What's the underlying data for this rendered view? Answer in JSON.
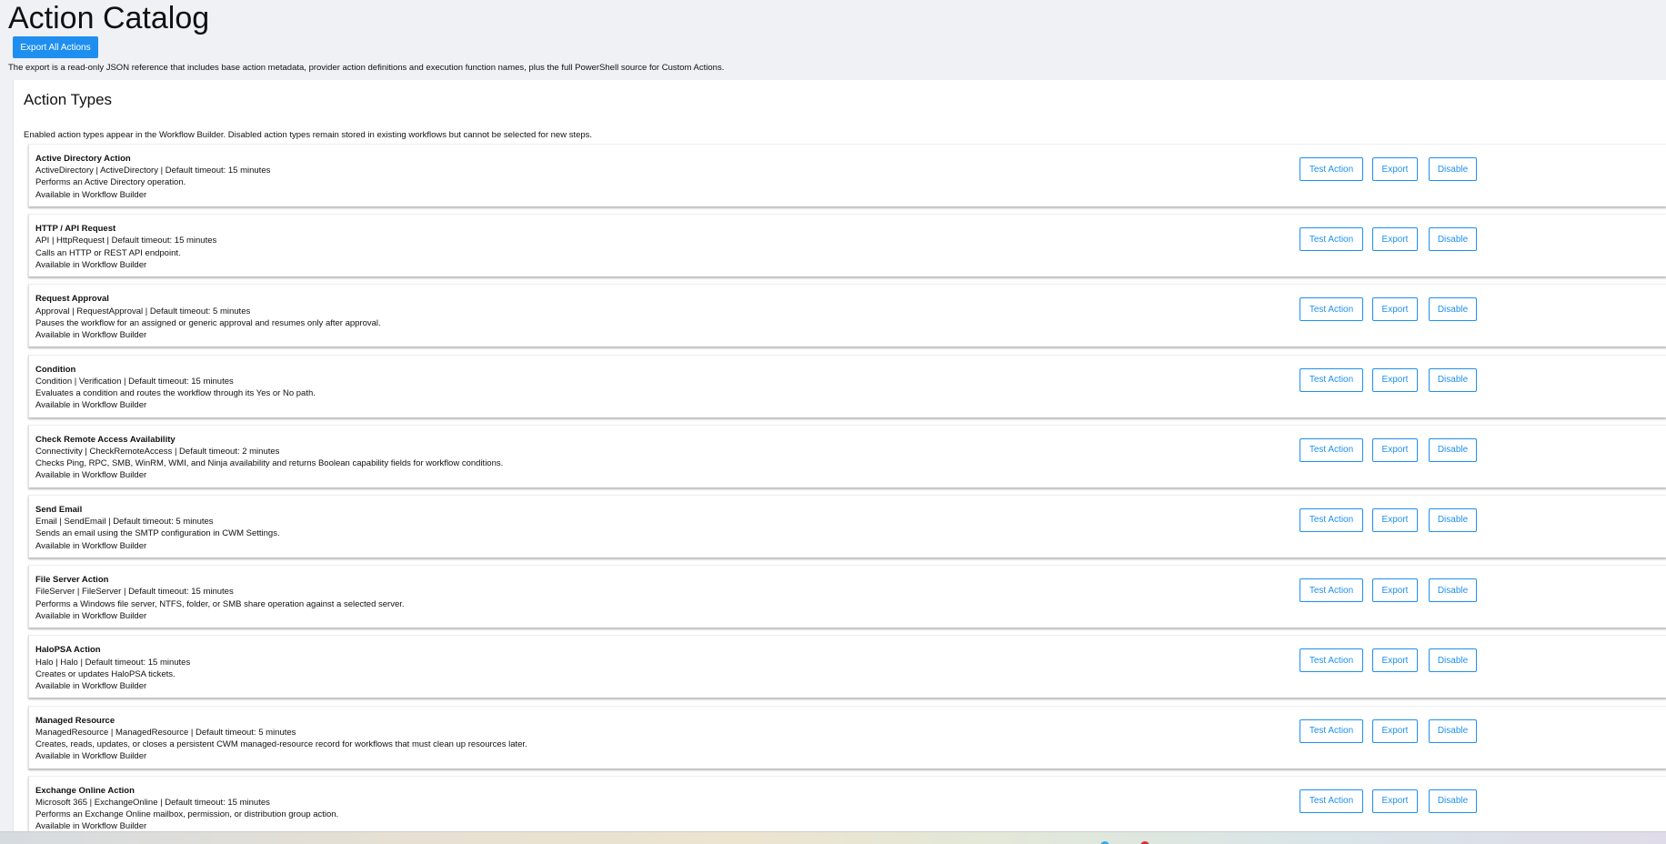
{
  "page": {
    "title": "Action Catalog",
    "export_all_label": "Export All Actions",
    "export_note": "The export is a read-only JSON reference that includes base action metadata, provider action definitions and execution function names, plus the full PowerShell source for Custom Actions."
  },
  "section": {
    "title": "Action Types",
    "note": "Enabled action types appear in the Workflow Builder. Disabled action types remain stored in existing workflows but cannot be selected for new steps."
  },
  "button_labels": {
    "test": "Test Action",
    "export": "Export",
    "disable": "Disable"
  },
  "actions": [
    {
      "name": "Active Directory Action",
      "meta": "ActiveDirectory | ActiveDirectory | Default timeout: 15 minutes",
      "description": "Performs an Active Directory operation.",
      "availability": "Available in Workflow Builder"
    },
    {
      "name": "HTTP / API Request",
      "meta": "API | HttpRequest | Default timeout: 15 minutes",
      "description": "Calls an HTTP or REST API endpoint.",
      "availability": "Available in Workflow Builder"
    },
    {
      "name": "Request Approval",
      "meta": "Approval | RequestApproval | Default timeout: 5 minutes",
      "description": "Pauses the workflow for an assigned or generic approval and resumes only after approval.",
      "availability": "Available in Workflow Builder"
    },
    {
      "name": "Condition",
      "meta": "Condition | Verification | Default timeout: 15 minutes",
      "description": "Evaluates a condition and routes the workflow through its Yes or No path.",
      "availability": "Available in Workflow Builder"
    },
    {
      "name": "Check Remote Access Availability",
      "meta": "Connectivity | CheckRemoteAccess | Default timeout: 2 minutes",
      "description": "Checks Ping, RPC, SMB, WinRM, WMI, and Ninja availability and returns Boolean capability fields for workflow conditions.",
      "availability": "Available in Workflow Builder"
    },
    {
      "name": "Send Email",
      "meta": "Email | SendEmail | Default timeout: 5 minutes",
      "description": "Sends an email using the SMTP configuration in CWM Settings.",
      "availability": "Available in Workflow Builder"
    },
    {
      "name": "File Server Action",
      "meta": "FileServer | FileServer | Default timeout: 15 minutes",
      "description": "Performs a Windows file server, NTFS, folder, or SMB share operation against a selected server.",
      "availability": "Available in Workflow Builder"
    },
    {
      "name": "HaloPSA Action",
      "meta": "Halo | Halo | Default timeout: 15 minutes",
      "description": "Creates or updates HaloPSA tickets.",
      "availability": "Available in Workflow Builder"
    },
    {
      "name": "Managed Resource",
      "meta": "ManagedResource | ManagedResource | Default timeout: 5 minutes",
      "description": "Creates, reads, updates, or closes a persistent CWM managed-resource record for workflows that must clean up resources later.",
      "availability": "Available in Workflow Builder"
    },
    {
      "name": "Exchange Online Action",
      "meta": "Microsoft 365 | ExchangeOnline | Default timeout: 15 minutes",
      "description": "Performs an Exchange Online mailbox, permission, or distribution group action.",
      "availability": "Available in Workflow Builder"
    }
  ],
  "colors": {
    "accent": "#1e8ff0",
    "page_background": "#f0f1f5",
    "panel_background": "#ffffff"
  }
}
